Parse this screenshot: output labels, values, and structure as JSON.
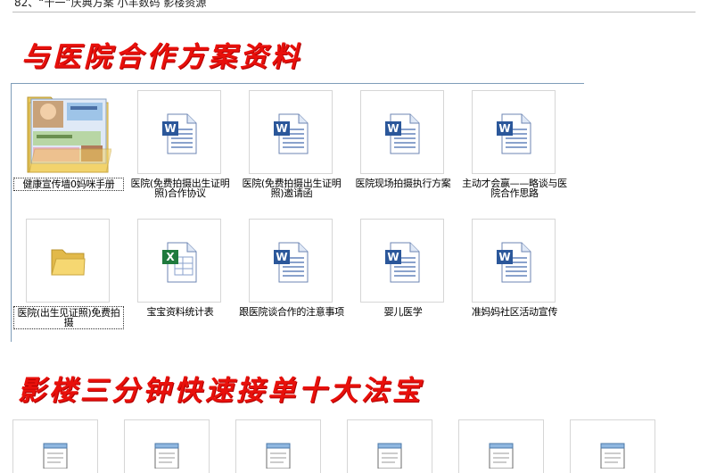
{
  "top_line": "82、“十一”庆典方案   小羊数码 影楼资源",
  "section1": {
    "title": "与医院合作方案资料",
    "items": [
      {
        "label": "健康宣传墙0妈咪手册",
        "icon": "folder-with-preview-icon",
        "selected": true
      },
      {
        "label": "医院(免费拍摄出生证明照)合作协议",
        "icon": "word-document-icon"
      },
      {
        "label": "医院(免费拍摄出生证明照)邀请函",
        "icon": "word-document-icon"
      },
      {
        "label": "医院现场拍摄执行方案",
        "icon": "word-document-icon"
      },
      {
        "label": "主动才会赢——略谈与医院合作思路",
        "icon": "word-document-icon"
      },
      {
        "label": "医院(出生见证照)免费拍摄",
        "icon": "folder-icon",
        "selected": true
      },
      {
        "label": "宝宝资料统计表",
        "icon": "excel-spreadsheet-icon"
      },
      {
        "label": "跟医院谈合作的注意事项",
        "icon": "word-document-icon"
      },
      {
        "label": "婴儿医学",
        "icon": "word-document-icon"
      },
      {
        "label": "准妈妈社区活动宣传",
        "icon": "word-document-icon"
      }
    ]
  },
  "section2": {
    "title": "影楼三分钟快速接单十大法宝",
    "items": [
      {
        "icon": "notepad-text-icon"
      },
      {
        "icon": "notepad-text-icon"
      },
      {
        "icon": "notepad-text-icon"
      },
      {
        "icon": "notepad-text-icon"
      },
      {
        "icon": "notepad-text-icon"
      },
      {
        "icon": "notepad-text-icon"
      }
    ]
  }
}
